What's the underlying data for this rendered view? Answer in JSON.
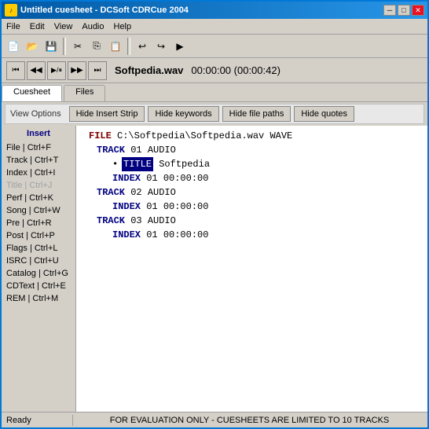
{
  "window": {
    "title": "Untitled cuesheet - DCSoft CDRCue 2004",
    "icon": "♪"
  },
  "menu": {
    "items": [
      "File",
      "Edit",
      "View",
      "Audio",
      "Help"
    ]
  },
  "toolbar": {
    "buttons": [
      {
        "icon": "📄",
        "name": "new"
      },
      {
        "icon": "📂",
        "name": "open"
      },
      {
        "icon": "💾",
        "name": "save"
      },
      {
        "icon": "✂",
        "name": "cut"
      },
      {
        "icon": "📋",
        "name": "copy"
      },
      {
        "icon": "📌",
        "name": "paste"
      },
      {
        "icon": "↩",
        "name": "undo"
      },
      {
        "icon": "↪",
        "name": "redo"
      },
      {
        "icon": "▶",
        "name": "play"
      }
    ]
  },
  "transport": {
    "filename": "Softpedia.wav",
    "time": "00:00:00",
    "duration": "(00:00:42)",
    "buttons": [
      "⏮",
      "◀◀",
      "▶/⏸",
      "▶▶",
      "⏭"
    ]
  },
  "tabs": [
    {
      "label": "Cuesheet",
      "active": true
    },
    {
      "label": "Files",
      "active": false
    }
  ],
  "view_options": {
    "label": "View Options",
    "buttons": [
      "Hide Insert Strip",
      "Hide keywords",
      "Hide file paths",
      "Hide quotes"
    ]
  },
  "insert_panel": {
    "title": "Insert",
    "items": [
      {
        "label": "File | Ctrl+F",
        "disabled": false
      },
      {
        "label": "Track | Ctrl+T",
        "disabled": false
      },
      {
        "label": "Index | Ctrl+I",
        "disabled": false
      },
      {
        "label": "Title | Ctrl+J",
        "disabled": true
      },
      {
        "label": "Perf | Ctrl+K",
        "disabled": false
      },
      {
        "label": "Song | Ctrl+W",
        "disabled": false
      },
      {
        "label": "Pre | Ctrl+R",
        "disabled": false
      },
      {
        "label": "Post | Ctrl+P",
        "disabled": false
      },
      {
        "label": "Flags | Ctrl+L",
        "disabled": false
      },
      {
        "label": "ISRC | Ctrl+U",
        "disabled": false
      },
      {
        "label": "Catalog | Ctrl+G",
        "disabled": false
      },
      {
        "label": "CDText | Ctrl+E",
        "disabled": false
      },
      {
        "label": "REM | Ctrl+M",
        "disabled": false
      }
    ]
  },
  "editor": {
    "lines": [
      {
        "type": "file",
        "indent": 0,
        "text": "FILE C:\\Softpedia\\Softpedia.wav WAVE"
      },
      {
        "type": "track",
        "indent": 1,
        "text": "TRACK 01 AUDIO"
      },
      {
        "type": "title",
        "indent": 2,
        "text": "TITLE",
        "value": "Softpedia",
        "hasBullet": true
      },
      {
        "type": "index",
        "indent": 2,
        "text": "INDEX 01 00:00:00"
      },
      {
        "type": "track",
        "indent": 1,
        "text": "TRACK 02 AUDIO"
      },
      {
        "type": "index",
        "indent": 2,
        "text": "INDEX 01 00:00:00"
      },
      {
        "type": "track",
        "indent": 1,
        "text": "TRACK 03 AUDIO"
      },
      {
        "type": "index",
        "indent": 2,
        "text": "INDEX 01 00:00:00"
      }
    ]
  },
  "status": {
    "left": "Ready",
    "right": "FOR EVALUATION ONLY - CUESHEETS ARE LIMITED TO 10 TRACKS"
  }
}
